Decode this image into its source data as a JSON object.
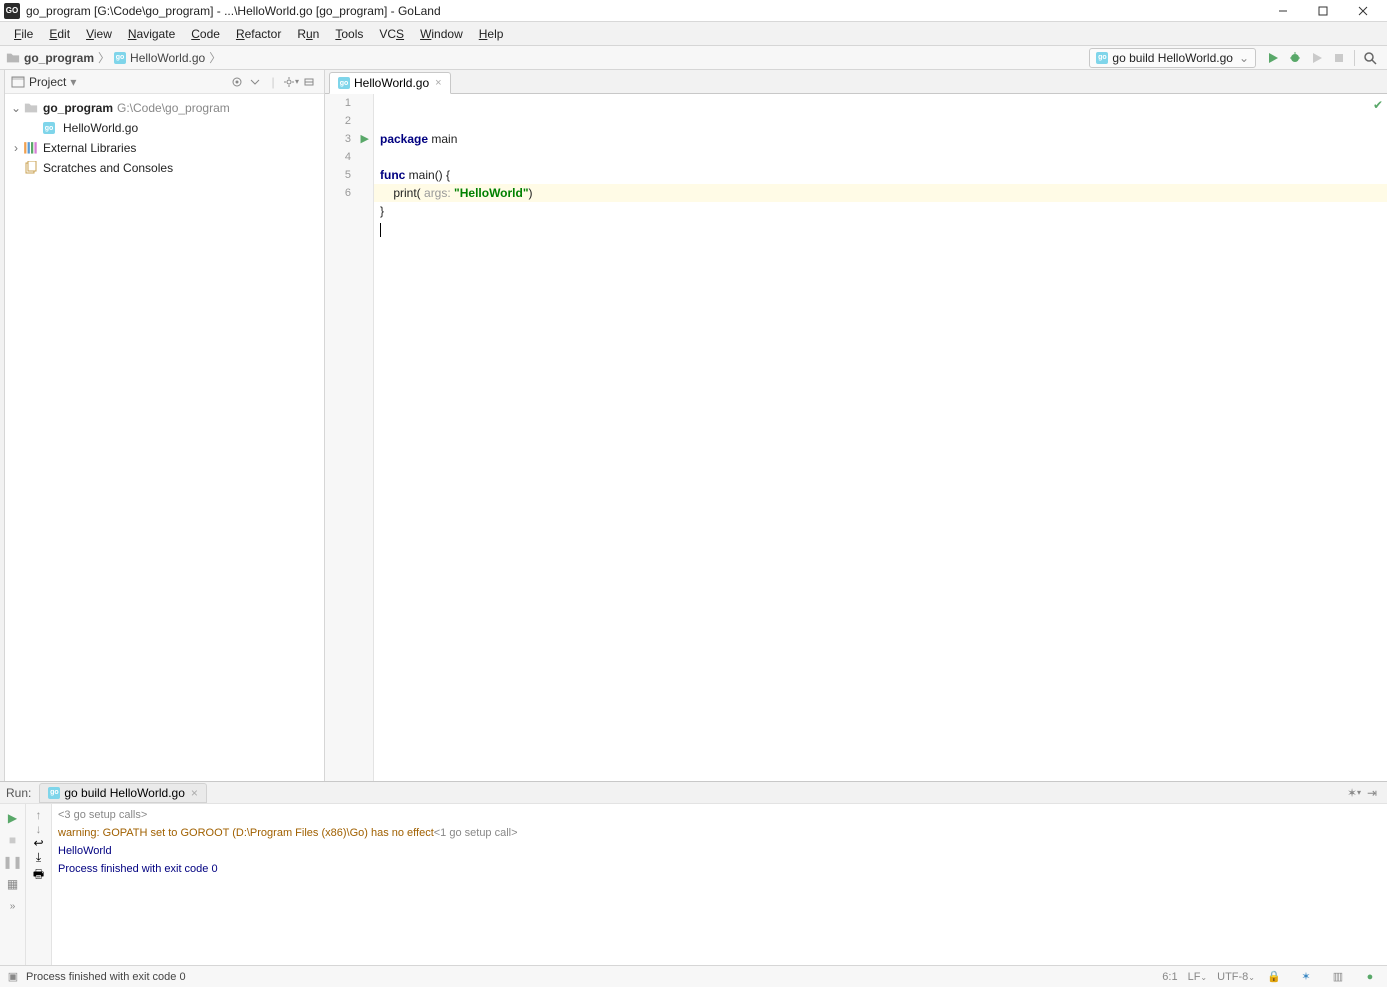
{
  "titlebar": {
    "app_badge": "GO",
    "title": "go_program [G:\\Code\\go_program] - ...\\HelloWorld.go [go_program] - GoLand"
  },
  "menu": [
    "File",
    "Edit",
    "View",
    "Navigate",
    "Code",
    "Refactor",
    "Run",
    "Tools",
    "VCS",
    "Window",
    "Help"
  ],
  "breadcrumb": {
    "root": "go_program",
    "file": "HelloWorld.go"
  },
  "run_config": "go build HelloWorld.go",
  "project_panel": {
    "title": "Project",
    "root_name": "go_program",
    "root_path": "G:\\Code\\go_program",
    "file": "HelloWorld.go",
    "external": "External Libraries",
    "scratches": "Scratches and Consoles"
  },
  "editor": {
    "tab": "HelloWorld.go",
    "lines": [
      "1",
      "2",
      "3",
      "4",
      "5",
      "6"
    ],
    "code": {
      "l1_k1": "package",
      "l1_t": " main",
      "l3_k1": "func",
      "l3_t": " main() {",
      "l4_pre": "    print( ",
      "l4_h": "args:",
      "l4_sp": " ",
      "l4_s": "\"HelloWorld\"",
      "l4_post": ")",
      "l5": "}"
    }
  },
  "run": {
    "label": "Run:",
    "tab": "go build HelloWorld.go",
    "line1_pre": "<3 go setup calls>",
    "line2_a": "warning: GOPATH set to GOROOT (D:\\Program Files (x86)\\Go) has no effect",
    "line2_b": "<1 go setup call>",
    "line3": "HelloWorld",
    "line4": "Process finished with exit code 0"
  },
  "status": {
    "msg": "Process finished with exit code 0",
    "pos": "6:1",
    "le": "LF",
    "enc": "UTF-8"
  }
}
